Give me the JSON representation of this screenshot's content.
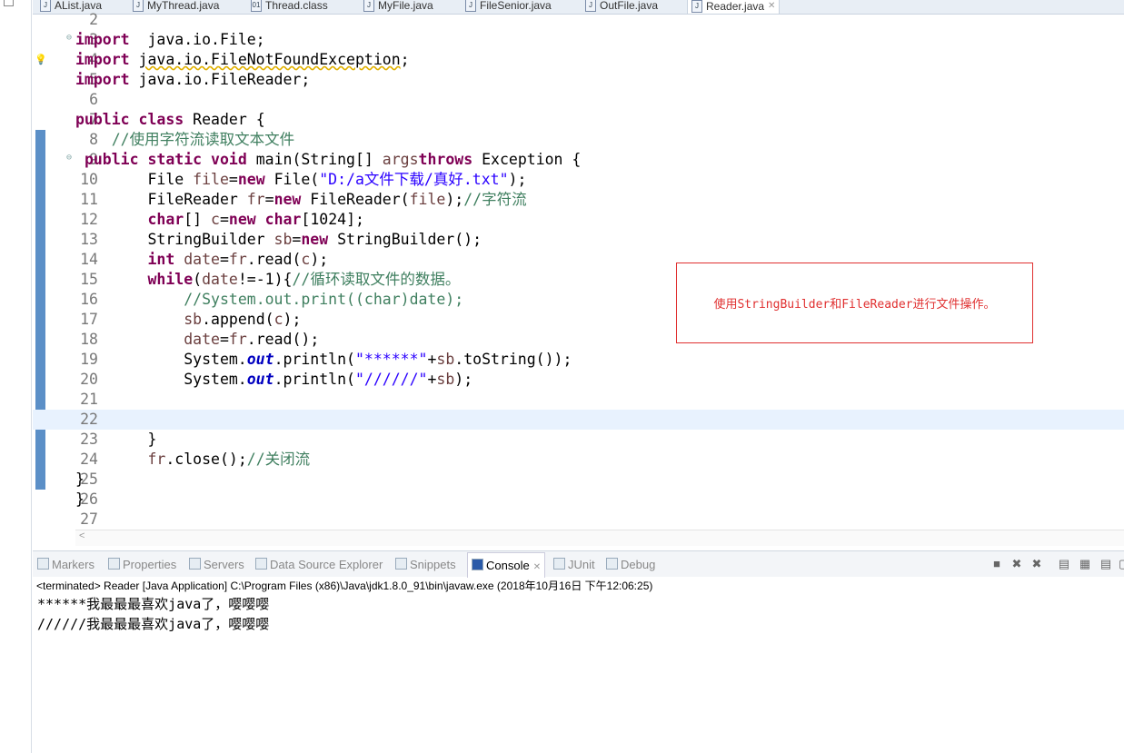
{
  "editor_tabs": [
    {
      "label": "AList.java",
      "icon": "java-file-icon"
    },
    {
      "label": "MyThread.java",
      "icon": "java-file-icon"
    },
    {
      "label": "Thread.class",
      "icon": "class-file-icon"
    },
    {
      "label": "MyFile.java",
      "icon": "java-file-icon"
    },
    {
      "label": "FileSenior.java",
      "icon": "java-file-warning-icon"
    },
    {
      "label": "OutFile.java",
      "icon": "java-file-warning-icon"
    },
    {
      "label": "Reader.java",
      "icon": "java-file-warning-icon",
      "active": true,
      "close": "✕"
    }
  ],
  "code": [
    {
      "n": "2",
      "t": []
    },
    {
      "n": "3",
      "fold": true,
      "t": [
        [
          "kw",
          "import"
        ],
        [
          "",
          "  java.io.File;"
        ]
      ]
    },
    {
      "n": "4",
      "warn": true,
      "t": [
        [
          "kw",
          "import"
        ],
        [
          "",
          " "
        ],
        [
          "warn",
          "java.io.FileNotFoundException"
        ],
        [
          "",
          ";"
        ]
      ]
    },
    {
      "n": "5",
      "t": [
        [
          "kw",
          "import"
        ],
        [
          "",
          " java.io.FileReader;"
        ]
      ]
    },
    {
      "n": "6",
      "t": []
    },
    {
      "n": "7",
      "t": [
        [
          "kw",
          "public"
        ],
        [
          "",
          " "
        ],
        [
          "kw",
          "class"
        ],
        [
          "",
          " Reader {"
        ]
      ]
    },
    {
      "n": "8",
      "t": [
        [
          "",
          "    "
        ],
        [
          "cm",
          "//使用字符流读取文本文件"
        ]
      ]
    },
    {
      "n": "9",
      "fold": true,
      "t": [
        [
          "",
          " "
        ],
        [
          "kw",
          "public"
        ],
        [
          "",
          " "
        ],
        [
          "kw",
          "static"
        ],
        [
          "",
          " "
        ],
        [
          "kw",
          "void"
        ],
        [
          "",
          " main(String[] "
        ],
        [
          "var",
          "args"
        ],
        [
          ") "
        ],
        [
          "kw",
          "throws"
        ],
        [
          "",
          " Exception {"
        ]
      ]
    },
    {
      "n": "10",
      "t": [
        [
          "",
          "        File "
        ],
        [
          "var",
          "file"
        ],
        [
          "",
          "="
        ],
        [
          "kw",
          "new"
        ],
        [
          "",
          " File("
        ],
        [
          "st",
          "\"D:/a文件下载/真好.txt\""
        ],
        [
          "",
          ");"
        ]
      ]
    },
    {
      "n": "11",
      "t": [
        [
          "",
          "        FileReader "
        ],
        [
          "var",
          "fr"
        ],
        [
          "",
          "="
        ],
        [
          "kw",
          "new"
        ],
        [
          "",
          " FileReader("
        ],
        [
          "var",
          "file"
        ],
        [
          "",
          ");"
        ],
        [
          "cm",
          "//字符流"
        ]
      ]
    },
    {
      "n": "12",
      "t": [
        [
          "",
          "        "
        ],
        [
          "kw",
          "char"
        ],
        [
          "",
          "[] "
        ],
        [
          "var",
          "c"
        ],
        [
          "",
          "="
        ],
        [
          "kw",
          "new"
        ],
        [
          "",
          " "
        ],
        [
          "kw",
          "char"
        ],
        [
          "",
          "[1024];"
        ]
      ]
    },
    {
      "n": "13",
      "t": [
        [
          "",
          "        StringBuilder "
        ],
        [
          "var",
          "sb"
        ],
        [
          "",
          "="
        ],
        [
          "kw",
          "new"
        ],
        [
          "",
          " StringBuilder();"
        ]
      ]
    },
    {
      "n": "14",
      "t": [
        [
          "",
          "        "
        ],
        [
          "kw",
          "int"
        ],
        [
          "",
          " "
        ],
        [
          "var",
          "date"
        ],
        [
          "",
          "="
        ],
        [
          "var",
          "fr"
        ],
        [
          "",
          ".read("
        ],
        [
          "var",
          "c"
        ],
        [
          "",
          ");"
        ]
      ]
    },
    {
      "n": "15",
      "t": [
        [
          "",
          "        "
        ],
        [
          "kw",
          "while"
        ],
        [
          "",
          "("
        ],
        [
          "var",
          "date"
        ],
        [
          "",
          "!=-1){"
        ],
        [
          "cm",
          "//循环读取文件的数据。"
        ]
      ]
    },
    {
      "n": "16",
      "t": [
        [
          "",
          "            "
        ],
        [
          "cm",
          "//System.out.print((char)date);"
        ]
      ]
    },
    {
      "n": "17",
      "t": [
        [
          "",
          "            "
        ],
        [
          "var",
          "sb"
        ],
        [
          "",
          ".append("
        ],
        [
          "var",
          "c"
        ],
        [
          "",
          ");"
        ]
      ]
    },
    {
      "n": "18",
      "t": [
        [
          "",
          "            "
        ],
        [
          "var",
          "date"
        ],
        [
          "",
          "="
        ],
        [
          "var",
          "fr"
        ],
        [
          "",
          ".read();"
        ]
      ]
    },
    {
      "n": "19",
      "t": [
        [
          "",
          "            System."
        ],
        [
          "fld",
          "out"
        ],
        [
          "",
          ".println("
        ],
        [
          "st",
          "\"******\""
        ],
        [
          "",
          "+"
        ],
        [
          "var",
          "sb"
        ],
        [
          "",
          ".toString());"
        ]
      ]
    },
    {
      "n": "20",
      "t": [
        [
          "",
          "            System."
        ],
        [
          "fld",
          "out"
        ],
        [
          "",
          ".println("
        ],
        [
          "st",
          "\"//////\""
        ],
        [
          "",
          "+"
        ],
        [
          "var",
          "sb"
        ],
        [
          "",
          ");"
        ]
      ]
    },
    {
      "n": "21",
      "t": []
    },
    {
      "n": "22",
      "current": true,
      "t": []
    },
    {
      "n": "23",
      "t": [
        [
          "",
          "        }"
        ]
      ]
    },
    {
      "n": "24",
      "t": [
        [
          "",
          "        "
        ],
        [
          "var",
          "fr"
        ],
        [
          "",
          ".close();"
        ],
        [
          "cm",
          "//关闭流"
        ]
      ]
    },
    {
      "n": "25",
      "t": [
        [
          "",
          "}"
        ]
      ]
    },
    {
      "n": "26",
      "t": [
        [
          "",
          "}"
        ]
      ]
    },
    {
      "n": "27",
      "t": []
    }
  ],
  "annotation": "使用StringBuilder和FileReader进行文件操作。",
  "scroll_arrow": "<",
  "console_tabs": [
    {
      "label": "Markers",
      "icon": "markers-icon"
    },
    {
      "label": "Properties",
      "icon": "properties-icon"
    },
    {
      "label": "Servers",
      "icon": "servers-icon"
    },
    {
      "label": "Data Source Explorer",
      "icon": "data-source-icon"
    },
    {
      "label": "Snippets",
      "icon": "snippets-icon"
    },
    {
      "label": "Console",
      "icon": "console-icon",
      "active": true,
      "close": "✕"
    },
    {
      "label": "JUnit",
      "icon": "junit-icon"
    },
    {
      "label": "Debug",
      "icon": "debug-icon"
    }
  ],
  "console_toolbar": [
    "terminate-icon",
    "remove-launch-icon",
    "remove-all-terminated-icon",
    "clear-console-icon",
    "scroll-lock-icon",
    "word-wrap-icon",
    "display-console-icon"
  ],
  "console_info": "<terminated> Reader [Java Application] C:\\Program Files (x86)\\Java\\jdk1.8.0_91\\bin\\javaw.exe (2018年10月16日 下午12:06:25)",
  "console_output": [
    "******我最最最喜欢java了，嘤嘤嘤",
    "//////我最最最喜欢java了，嘤嘤嘤"
  ]
}
